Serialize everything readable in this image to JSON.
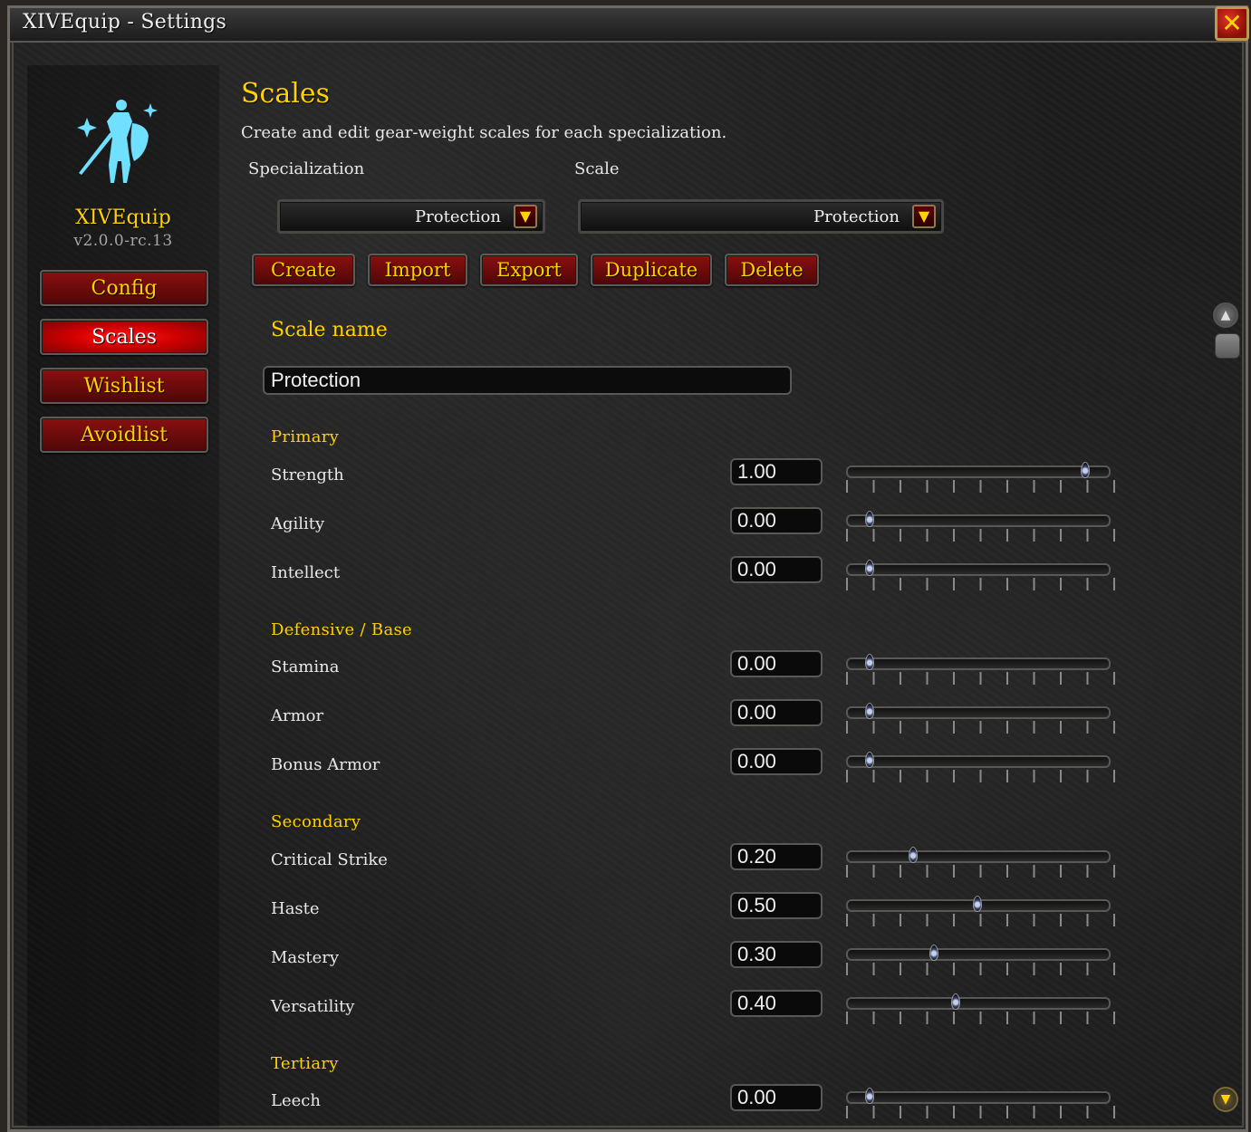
{
  "window": {
    "title": "XIVEquip - Settings",
    "close_icon": "close-icon"
  },
  "sidebar": {
    "addon_name": "XIVEquip",
    "version": "v2.0.0-rc.13",
    "logo_icon": "knight-sword-shield-icon",
    "items": [
      {
        "label": "Config",
        "active": false
      },
      {
        "label": "Scales",
        "active": true
      },
      {
        "label": "Wishlist",
        "active": false
      },
      {
        "label": "Avoidlist",
        "active": false
      }
    ]
  },
  "main": {
    "title": "Scales",
    "description": "Create and edit gear-weight scales for each specialization.",
    "specialization_label": "Specialization",
    "specialization_value": "Protection",
    "scale_label": "Scale",
    "scale_value": "Protection",
    "actions": [
      "Create",
      "Import",
      "Export",
      "Duplicate",
      "Delete"
    ],
    "scale_name_label": "Scale name",
    "scale_name_value": "Protection"
  },
  "slider_range": [
    0,
    1
  ],
  "sections": [
    {
      "title": "Primary",
      "stats": [
        {
          "label": "Strength",
          "value": "1.00"
        },
        {
          "label": "Agility",
          "value": "0.00"
        },
        {
          "label": "Intellect",
          "value": "0.00"
        }
      ]
    },
    {
      "title": "Defensive / Base",
      "stats": [
        {
          "label": "Stamina",
          "value": "0.00"
        },
        {
          "label": "Armor",
          "value": "0.00"
        },
        {
          "label": "Bonus Armor",
          "value": "0.00"
        }
      ]
    },
    {
      "title": "Secondary",
      "stats": [
        {
          "label": "Critical Strike",
          "value": "0.20"
        },
        {
          "label": "Haste",
          "value": "0.50"
        },
        {
          "label": "Mastery",
          "value": "0.30"
        },
        {
          "label": "Versatility",
          "value": "0.40"
        }
      ]
    },
    {
      "title": "Tertiary",
      "stats": [
        {
          "label": "Leech",
          "value": "0.00"
        }
      ]
    }
  ],
  "colors": {
    "accent": "#ffd100",
    "button_red": "#8a1010",
    "active_red": "#e00000"
  }
}
